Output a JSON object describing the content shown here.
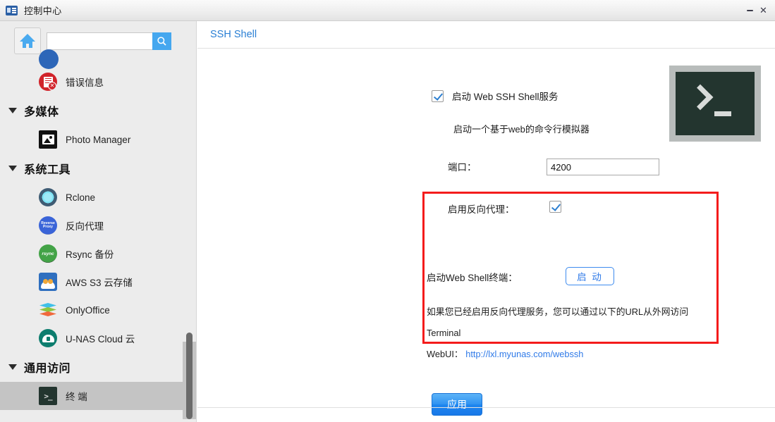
{
  "window": {
    "title": "控制中心",
    "icon": "control-center-icon",
    "minimize_label": "—",
    "close_label": "✕"
  },
  "sidebar": {
    "home_button_icon": "home-icon",
    "search": {
      "value": "",
      "placeholder": "",
      "button_icon": "search-icon"
    },
    "items": [
      {
        "type": "item",
        "label": "错误信息",
        "icon": "error-info-icon",
        "selected": false
      },
      {
        "type": "group",
        "label": "多媒体",
        "icon": "caret-down-icon"
      },
      {
        "type": "item",
        "label": "Photo Manager",
        "icon": "photo-manager-icon",
        "selected": false
      },
      {
        "type": "group",
        "label": "系统工具",
        "icon": "caret-down-icon"
      },
      {
        "type": "item",
        "label": "Rclone",
        "icon": "rclone-icon",
        "selected": false
      },
      {
        "type": "item",
        "label": "反向代理",
        "icon": "reverse-proxy-icon",
        "selected": false
      },
      {
        "type": "item",
        "label": "Rsync 备份",
        "icon": "rsync-backup-icon",
        "selected": false
      },
      {
        "type": "item",
        "label": "AWS S3 云存储",
        "icon": "aws-s3-icon",
        "selected": false
      },
      {
        "type": "item",
        "label": "OnlyOffice",
        "icon": "onlyoffice-icon",
        "selected": false
      },
      {
        "type": "item",
        "label": "U-NAS Cloud 云",
        "icon": "unas-cloud-icon",
        "selected": false
      },
      {
        "type": "group",
        "label": "通用访问",
        "icon": "caret-down-icon"
      },
      {
        "type": "item",
        "label": "终 端",
        "icon": "terminal-icon",
        "selected": true
      }
    ]
  },
  "main": {
    "header_title": "SSH Shell",
    "terminal_badge_icon": "terminal-prompt-icon",
    "enable_service": {
      "label": "启动 Web SSH Shell服务",
      "checked": true,
      "description": "启动一个基于web的命令行模拟器"
    },
    "port": {
      "label": "端口：",
      "value": "4200",
      "placeholder": ""
    },
    "reverse_proxy": {
      "enable_label": "启用反向代理：",
      "enable_checked": true,
      "launch_label": "启动Web Shell终端：",
      "launch_button": "启 动",
      "hint_line1": "如果您已经启用反向代理服务，您可以通过以下的URL从外网访问Terminal",
      "hint_line2_prefix": "WebUI：",
      "hint_url": "http://lxl.myunas.com/webssh"
    },
    "apply_button": "应用"
  },
  "colors": {
    "accent_blue": "#2a7fd4",
    "link_blue": "#2f7ae8",
    "alert_red": "#f41c1c",
    "terminal_dark": "#23352f",
    "search_blue": "#45a7ef",
    "selected_gray": "#c4c4c4"
  }
}
